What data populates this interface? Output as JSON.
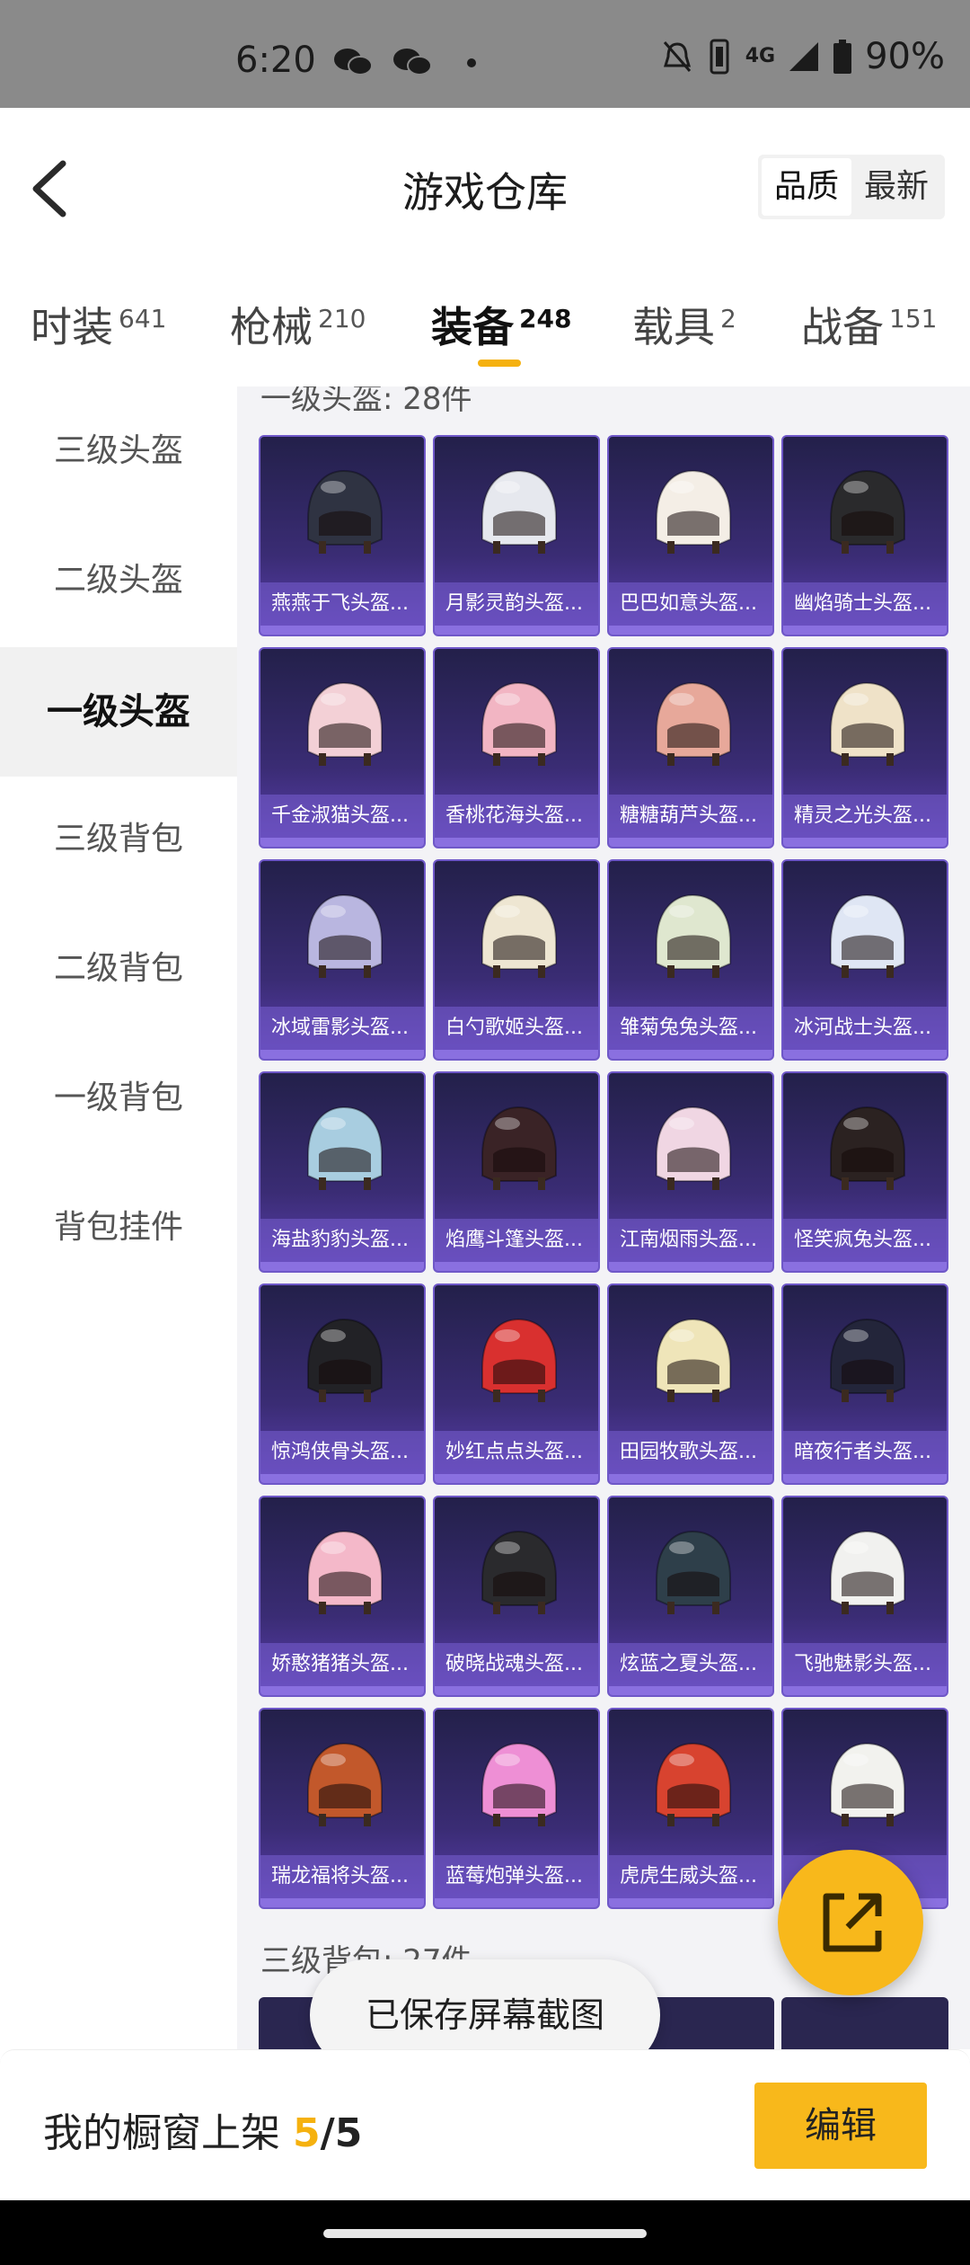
{
  "status_bar": {
    "time": "6:20",
    "battery": "90%",
    "network": "4G",
    "icons": [
      "wechat-icon",
      "wechat-icon",
      "dot-icon",
      "mute-icon",
      "vibrate-icon",
      "signal-icon",
      "battery-icon"
    ]
  },
  "header": {
    "title": "游戏仓库",
    "sort_options": [
      "品质",
      "最新"
    ],
    "active_sort": "品质"
  },
  "tabs": [
    {
      "label": "时装",
      "count": "641"
    },
    {
      "label": "枪械",
      "count": "210"
    },
    {
      "label": "装备",
      "count": "248",
      "active": true
    },
    {
      "label": "载具",
      "count": "2"
    },
    {
      "label": "战备",
      "count": "151"
    }
  ],
  "sidebar": {
    "items": [
      "三级头盔",
      "二级头盔",
      "一级头盔",
      "三级背包",
      "二级背包",
      "一级背包",
      "背包挂件"
    ],
    "active_index": 2
  },
  "content": {
    "section_title": "一级头盔: 28件",
    "next_section_title": "三级背包: 27件",
    "items": [
      {
        "name": "燕燕于飞头盔...",
        "color": "#2f3342"
      },
      {
        "name": "月影灵韵头盔...",
        "color": "#e6e8ee"
      },
      {
        "name": "巴巴如意头盔...",
        "color": "#f4eee6"
      },
      {
        "name": "幽焰骑士头盔...",
        "color": "#2a2a2c"
      },
      {
        "name": "千金淑猫头盔...",
        "color": "#f3d0d6"
      },
      {
        "name": "香桃花海头盔...",
        "color": "#f2b5c3"
      },
      {
        "name": "糖糖葫芦头盔...",
        "color": "#e7a89a"
      },
      {
        "name": "精灵之光头盔...",
        "color": "#efe2c8"
      },
      {
        "name": "冰域雷影头盔...",
        "color": "#b9b6e0"
      },
      {
        "name": "白勺歌姬头盔...",
        "color": "#eee6d2"
      },
      {
        "name": "雏菊兔兔头盔...",
        "color": "#dfe7cf"
      },
      {
        "name": "冰河战士头盔...",
        "color": "#dfe6f4"
      },
      {
        "name": "海盐豹豹头盔...",
        "color": "#a8cde0"
      },
      {
        "name": "焰鹰斗篷头盔...",
        "color": "#3a2326"
      },
      {
        "name": "江南烟雨头盔...",
        "color": "#f0d6e3"
      },
      {
        "name": "怪笑疯兔头盔...",
        "color": "#2b2221"
      },
      {
        "name": "惊鸿侠骨头盔...",
        "color": "#222226"
      },
      {
        "name": "妙红点点头盔...",
        "color": "#d9302f"
      },
      {
        "name": "田园牧歌头盔...",
        "color": "#efe5b9"
      },
      {
        "name": "暗夜行者头盔...",
        "color": "#23253a"
      },
      {
        "name": "娇憨猪猪头盔...",
        "color": "#f4b8c9"
      },
      {
        "name": "破晓战魂头盔...",
        "color": "#2a2a2d"
      },
      {
        "name": "炫蓝之夏头盔...",
        "color": "#2e3f4a"
      },
      {
        "name": "飞驰魅影头盔...",
        "color": "#f1f1ef"
      },
      {
        "name": "瑞龙福将头盔...",
        "color": "#c2582b"
      },
      {
        "name": "蓝莓炮弹头盔...",
        "color": "#ee8fd5"
      },
      {
        "name": "虎虎生威头盔...",
        "color": "#d8432f"
      },
      {
        "name": "",
        "color": "#f2f2ee"
      }
    ]
  },
  "toast": "已保存屏幕截图",
  "footer": {
    "label": "我的橱窗上架 ",
    "current": "5",
    "separator": "/",
    "max": "5",
    "edit_label": "编辑"
  },
  "colors": {
    "accent": "#f8b81b",
    "card_bg": "#3a2c74"
  }
}
